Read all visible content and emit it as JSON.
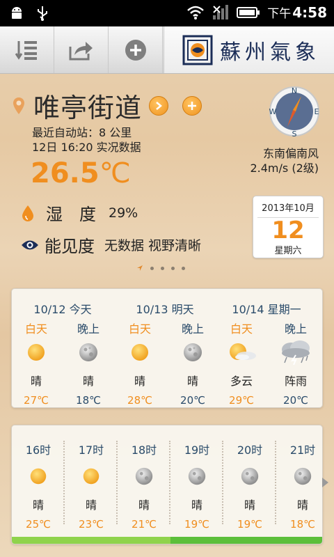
{
  "status_bar": {
    "ampm": "下午",
    "time": "4:58"
  },
  "header": {
    "logo_text": "蘇州氣象"
  },
  "location": {
    "name": "唯亭街道",
    "station_distance": "最近自动站：8 公里",
    "observation_time": "12日 16:20 实况数据",
    "temperature_value": "26.5",
    "temperature_unit": "℃",
    "humidity_label": "湿　度",
    "humidity_value": "29%",
    "visibility_label": "能见度",
    "visibility_value": "无数据 视野清晰"
  },
  "compass": {
    "n": "N",
    "e": "E",
    "s": "S",
    "w": "W"
  },
  "wind": {
    "direction": "东南偏南风",
    "speed": "2.4m/s (2级)"
  },
  "date_card": {
    "year_month": "2013年10月",
    "day": "12",
    "weekday": "星期六"
  },
  "daily": [
    {
      "date": "10/12 今天",
      "day": {
        "period": "白天",
        "icon": "sun-icon",
        "text": "晴",
        "temp": "27℃"
      },
      "night": {
        "period": "晚上",
        "icon": "moon-icon",
        "text": "晴",
        "temp": "18℃"
      }
    },
    {
      "date": "10/13 明天",
      "day": {
        "period": "白天",
        "icon": "sun-icon",
        "text": "晴",
        "temp": "28℃"
      },
      "night": {
        "period": "晚上",
        "icon": "moon-icon",
        "text": "晴",
        "temp": "20℃"
      }
    },
    {
      "date": "10/14 星期一",
      "day": {
        "period": "白天",
        "icon": "partly-cloudy-icon",
        "text": "多云",
        "temp": "29℃"
      },
      "night": {
        "period": "晚上",
        "icon": "thunder-shower-icon",
        "text": "阵雨",
        "temp": "20℃"
      }
    }
  ],
  "hourly": [
    {
      "hour": "16时",
      "icon": "sun-icon",
      "text": "晴",
      "temp": "25℃"
    },
    {
      "hour": "17时",
      "icon": "sun-icon",
      "text": "晴",
      "temp": "23℃"
    },
    {
      "hour": "18时",
      "icon": "moon-icon",
      "text": "晴",
      "temp": "21℃"
    },
    {
      "hour": "19时",
      "icon": "moon-icon",
      "text": "晴",
      "temp": "19℃"
    },
    {
      "hour": "20时",
      "icon": "moon-icon",
      "text": "晴",
      "temp": "19℃"
    },
    {
      "hour": "21时",
      "icon": "moon-icon",
      "text": "晴",
      "temp": "18℃"
    }
  ],
  "colors": {
    "accent_orange": "#f08e1f",
    "text_blue": "#2a4b6a",
    "bar_green": "#8fd34c",
    "bar_dark_green": "#5cbf3a"
  }
}
